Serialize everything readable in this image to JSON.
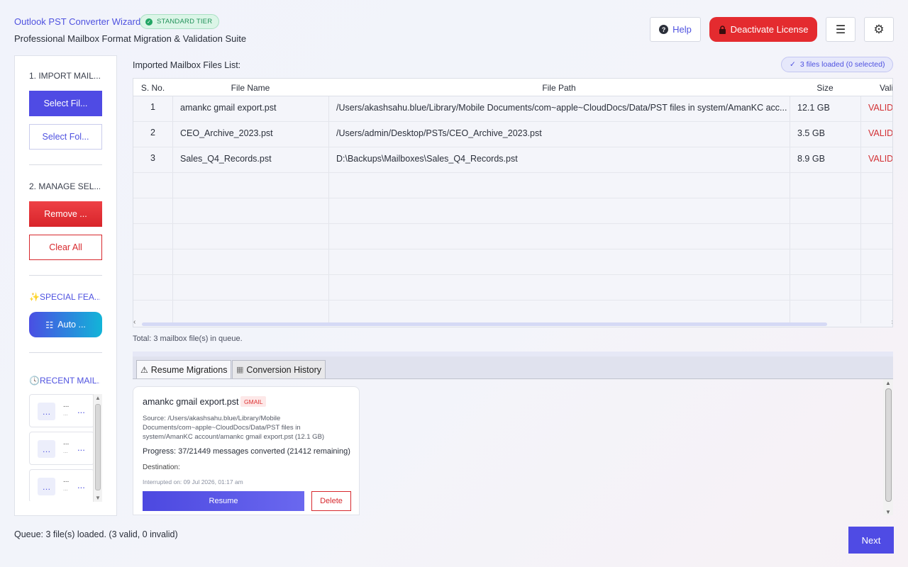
{
  "header": {
    "title": "Outlook PST Converter Wizard",
    "tier": "STANDARD TIER",
    "subtitle": "Professional Mailbox Format Migration & Validation Suite",
    "help_label": "Help",
    "deactivate_label": "Deactivate License"
  },
  "sidebar": {
    "import_label": "1. IMPORT MAIL...",
    "select_files_label": "Select Fil...",
    "select_folder_label": "Select Fol...",
    "manage_label": "2. MANAGE SEL...",
    "remove_label": "Remove ...",
    "clear_all_label": "Clear All",
    "special_label": "✨SPECIAL FEA...",
    "auto_label": "Auto ...",
    "recent_label": "🕓RECENT MAIL...",
    "recent_items": [
      {
        "title": "...",
        "sub": "...",
        "more": "..."
      },
      {
        "title": "...",
        "sub": "...",
        "more": "..."
      },
      {
        "title": "...",
        "sub": "...",
        "more": "..."
      }
    ]
  },
  "files": {
    "heading": "Imported Mailbox Files List:",
    "loaded_badge": "3 files loaded (0 selected)",
    "columns": [
      "S. No.",
      "File Name",
      "File Path",
      "Size",
      "Vali"
    ],
    "rows": [
      {
        "no": "1",
        "name": "amankc gmail export.pst",
        "path": "/Users/akashsahu.blue/Library/Mobile Documents/com~apple~CloudDocs/Data/PST files in system/AmanKC acc...",
        "size": "12.1 GB",
        "valid": "VALID"
      },
      {
        "no": "2",
        "name": "CEO_Archive_2023.pst",
        "path": "/Users/admin/Desktop/PSTs/CEO_Archive_2023.pst",
        "size": "3.5 GB",
        "valid": "VALID"
      },
      {
        "no": "3",
        "name": "Sales_Q4_Records.pst",
        "path": "D:\\Backups\\Mailboxes\\Sales_Q4_Records.pst",
        "size": "8.9 GB",
        "valid": "VALID"
      }
    ],
    "total": "Total: 3 mailbox file(s) in queue."
  },
  "tabs": {
    "resume": "Resume Migrations",
    "history": "Conversion History"
  },
  "resume_card": {
    "name": "amankc gmail export.pst",
    "tag": "GMAIL",
    "source": "Source: /Users/akashsahu.blue/Library/Mobile Documents/com~apple~CloudDocs/Data/PST files in system/AmanKC account/amankc gmail export.pst (12.1 GB)",
    "progress": "Progress: 37/21449 messages converted (21412 remaining)",
    "destination": "Destination:",
    "interrupted": "Interrupted on: 09 Jul 2026, 01:17 am",
    "resume_label": "Resume",
    "delete_label": "Delete"
  },
  "footer": {
    "queue_status": "Queue: 3 file(s) loaded. (3 valid, 0 invalid)",
    "next_label": "Next"
  },
  "colors": {
    "accent": "#4f4be4",
    "danger": "#e42b2f",
    "success": "#22a564"
  }
}
